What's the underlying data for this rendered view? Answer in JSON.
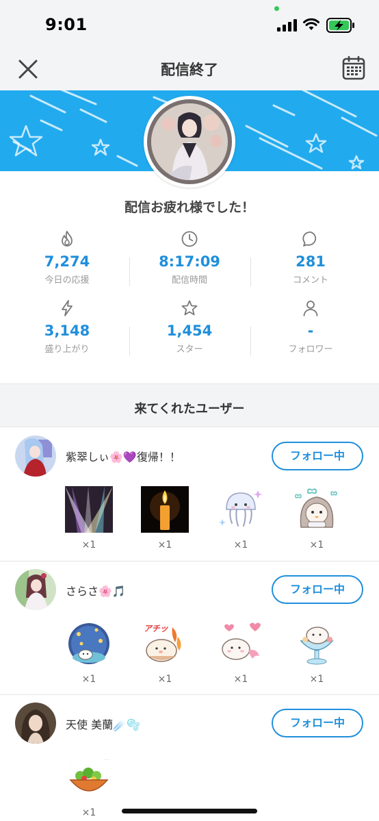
{
  "status_bar": {
    "time": "9:01"
  },
  "header": {
    "title": "配信終了"
  },
  "summary": {
    "greeting": "配信お疲れ様でした！"
  },
  "stats": [
    {
      "icon": "flame-icon",
      "value": "7,274",
      "label": "今日の応援"
    },
    {
      "icon": "clock-icon",
      "value": "8:17:09",
      "label": "配信時間"
    },
    {
      "icon": "comment-icon",
      "value": "281",
      "label": "コメント"
    },
    {
      "icon": "lightning-icon",
      "value": "3,148",
      "label": "盛り上がり"
    },
    {
      "icon": "star-icon",
      "value": "1,454",
      "label": "スター"
    },
    {
      "icon": "person-icon",
      "value": "-",
      "label": "フォロワー"
    }
  ],
  "visitors": {
    "title": "来てくれたユーザー",
    "users": [
      {
        "name": "紫翠しぃ🌸💜復帰！！",
        "follow_label": "フォロー中",
        "gifts": [
          {
            "icon": "spotlight-gift-icon",
            "count": "×1"
          },
          {
            "icon": "candle-gift-icon",
            "count": "×1"
          },
          {
            "icon": "jellyfish-gift-icon",
            "count": "×1"
          },
          {
            "icon": "penguin-hood-gift-icon",
            "count": "×1"
          }
        ]
      },
      {
        "name": "さらさ🌸🎵",
        "follow_label": "フォロー中",
        "gifts": [
          {
            "icon": "lantern-cat-gift-icon",
            "count": "×1"
          },
          {
            "icon": "hot-cat-gift-icon",
            "label": "アチッ",
            "count": "×1"
          },
          {
            "icon": "mermaid-cat-gift-icon",
            "count": "×1"
          },
          {
            "icon": "parfait-cat-gift-icon",
            "count": "×1"
          }
        ]
      },
      {
        "name": "天使 美蘭☄️🫧",
        "follow_label": "フォロー中",
        "gifts": [
          {
            "icon": "salad-bar-gift-icon",
            "label": "サラダバー",
            "count": "×1"
          }
        ]
      }
    ]
  },
  "colors": {
    "accent": "#1f8fdc",
    "banner": "#22aaee",
    "background": "#f3f4f6"
  }
}
